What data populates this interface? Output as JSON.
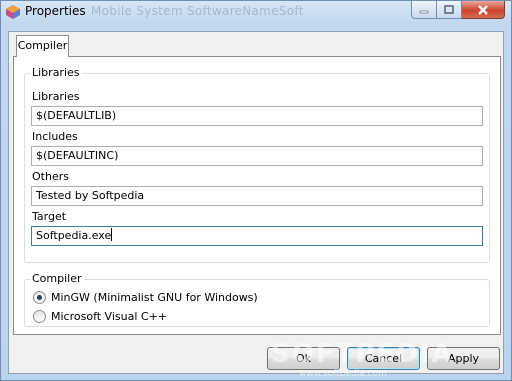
{
  "window": {
    "title": "Properties",
    "title_ghost": "Mobile System   SoftwareNameSoft"
  },
  "tabs": [
    {
      "label": "Compiler"
    }
  ],
  "libraries_group": {
    "title": "Libraries",
    "fields": [
      {
        "label": "Libraries",
        "value": "$(DEFAULTLIB)"
      },
      {
        "label": "Includes",
        "value": "$(DEFAULTINC)"
      },
      {
        "label": "Others",
        "value": "Tested by Softpedia"
      },
      {
        "label": "Target",
        "value": "Softpedia.exe"
      }
    ]
  },
  "compiler_group": {
    "title": "Compiler",
    "options": [
      {
        "label": "MinGW (Minimalist GNU for Windows)",
        "checked": true
      },
      {
        "label": "Microsoft Visual C++",
        "checked": false
      }
    ]
  },
  "buttons": {
    "ok": "Ok",
    "cancel": "Cancel",
    "apply": "Apply"
  },
  "watermark": {
    "main": "SOFTPEDIA",
    "sub": "www.softpedia.com"
  },
  "colors": {
    "accent": "#3c7fb1",
    "close_button": "#c8452e"
  }
}
